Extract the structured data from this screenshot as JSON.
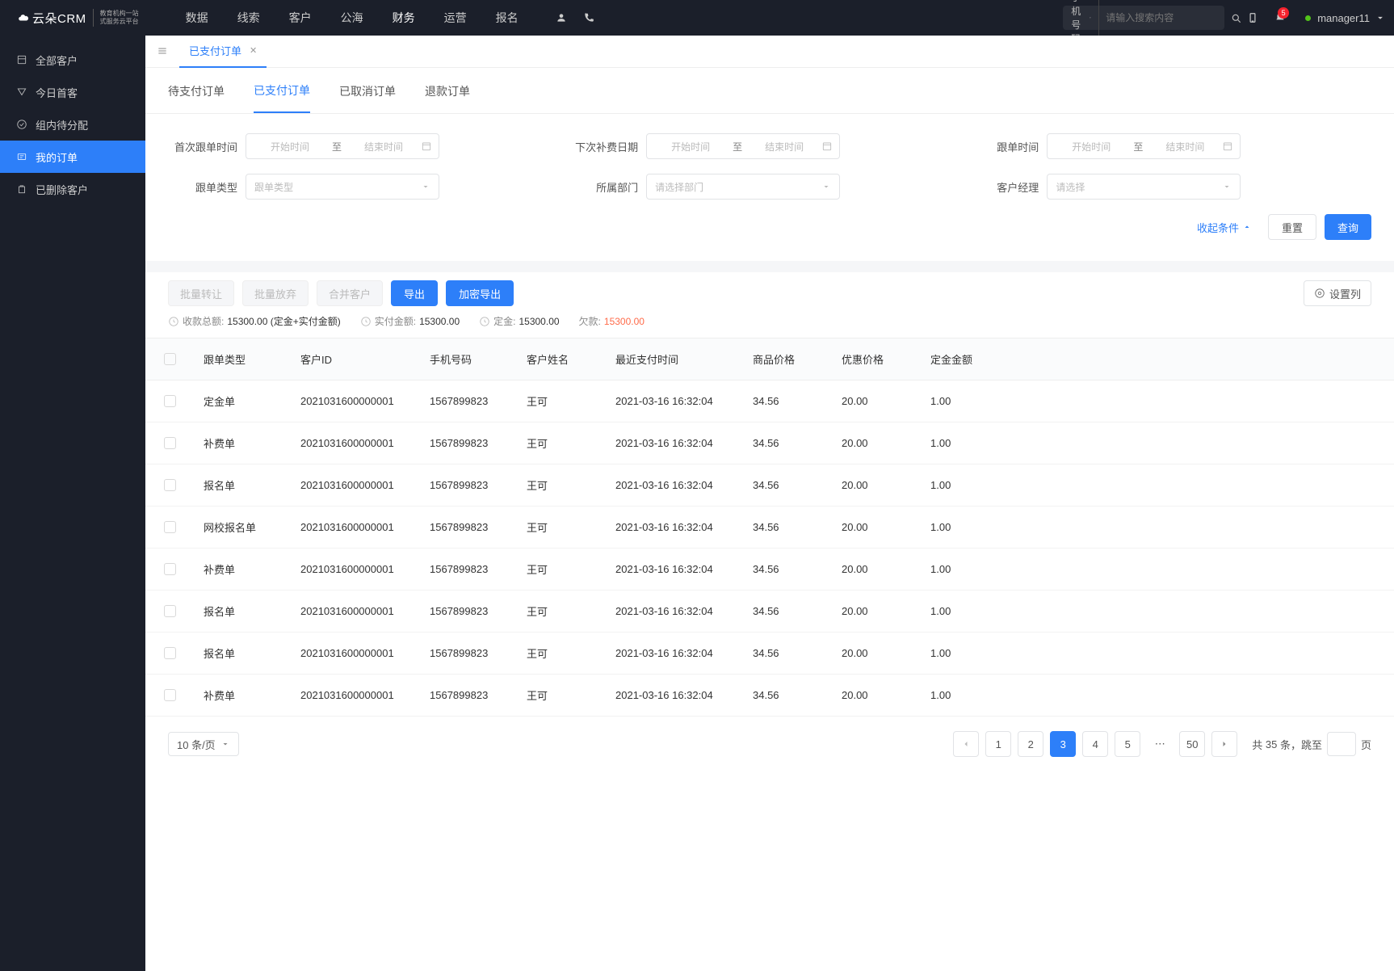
{
  "brand": {
    "name": "云朵CRM",
    "sub1": "教育机构一站",
    "sub2": "式服务云平台"
  },
  "topNav": [
    "数据",
    "线索",
    "客户",
    "公海",
    "财务",
    "运营",
    "报名"
  ],
  "topNavActive": "财务",
  "search": {
    "type": "手机号码",
    "placeholder": "请输入搜索内容"
  },
  "notificationCount": "5",
  "username": "manager11",
  "sidebar": {
    "items": [
      {
        "label": "全部客户"
      },
      {
        "label": "今日首客"
      },
      {
        "label": "组内待分配"
      },
      {
        "label": "我的订单"
      },
      {
        "label": "已删除客户"
      }
    ],
    "activeIndex": 3
  },
  "openTab": {
    "label": "已支付订单"
  },
  "subTabs": [
    "待支付订单",
    "已支付订单",
    "已取消订单",
    "退款订单"
  ],
  "subTabActive": "已支付订单",
  "filters": {
    "firstFollow": {
      "label": "首次跟单时间",
      "startPh": "开始时间",
      "sep": "至",
      "endPh": "结束时间"
    },
    "nextPay": {
      "label": "下次补费日期",
      "startPh": "开始时间",
      "sep": "至",
      "endPh": "结束时间"
    },
    "followTime": {
      "label": "跟单时间",
      "startPh": "开始时间",
      "sep": "至",
      "endPh": "结束时间"
    },
    "followType": {
      "label": "跟单类型",
      "placeholder": "跟单类型"
    },
    "dept": {
      "label": "所属部门",
      "placeholder": "请选择部门"
    },
    "manager": {
      "label": "客户经理",
      "placeholder": "请选择"
    },
    "collapse": "收起条件",
    "reset": "重置",
    "query": "查询"
  },
  "toolbar": {
    "batchTransfer": "批量转让",
    "batchGiveUp": "批量放弃",
    "mergeCustomer": "合并客户",
    "export": "导出",
    "encryptExport": "加密导出",
    "settings": "设置列"
  },
  "summary": {
    "total": {
      "label": "收款总额:",
      "value": "15300.00 (定金+实付金额)"
    },
    "paid": {
      "label": "实付金额:",
      "value": "15300.00"
    },
    "deposit": {
      "label": "定金:",
      "value": "15300.00"
    },
    "owe": {
      "label": "欠款:",
      "value": "15300.00"
    }
  },
  "table": {
    "headers": {
      "type": "跟单类型",
      "cid": "客户ID",
      "phone": "手机号码",
      "name": "客户姓名",
      "time": "最近支付时间",
      "price": "商品价格",
      "discount": "优惠价格",
      "deposit": "定金金额"
    },
    "rows": [
      {
        "type": "定金单",
        "cid": "2021031600000001",
        "phone": "1567899823",
        "name": "王可",
        "time": "2021-03-16 16:32:04",
        "price": "34.56",
        "discount": "20.00",
        "deposit": "1.00"
      },
      {
        "type": "补费单",
        "cid": "2021031600000001",
        "phone": "1567899823",
        "name": "王可",
        "time": "2021-03-16 16:32:04",
        "price": "34.56",
        "discount": "20.00",
        "deposit": "1.00"
      },
      {
        "type": "报名单",
        "cid": "2021031600000001",
        "phone": "1567899823",
        "name": "王可",
        "time": "2021-03-16 16:32:04",
        "price": "34.56",
        "discount": "20.00",
        "deposit": "1.00"
      },
      {
        "type": "网校报名单",
        "cid": "2021031600000001",
        "phone": "1567899823",
        "name": "王可",
        "time": "2021-03-16 16:32:04",
        "price": "34.56",
        "discount": "20.00",
        "deposit": "1.00"
      },
      {
        "type": "补费单",
        "cid": "2021031600000001",
        "phone": "1567899823",
        "name": "王可",
        "time": "2021-03-16 16:32:04",
        "price": "34.56",
        "discount": "20.00",
        "deposit": "1.00"
      },
      {
        "type": "报名单",
        "cid": "2021031600000001",
        "phone": "1567899823",
        "name": "王可",
        "time": "2021-03-16 16:32:04",
        "price": "34.56",
        "discount": "20.00",
        "deposit": "1.00"
      },
      {
        "type": "报名单",
        "cid": "2021031600000001",
        "phone": "1567899823",
        "name": "王可",
        "time": "2021-03-16 16:32:04",
        "price": "34.56",
        "discount": "20.00",
        "deposit": "1.00"
      },
      {
        "type": "补费单",
        "cid": "2021031600000001",
        "phone": "1567899823",
        "name": "王可",
        "time": "2021-03-16 16:32:04",
        "price": "34.56",
        "discount": "20.00",
        "deposit": "1.00"
      }
    ]
  },
  "pagination": {
    "pageSize": "10 条/页",
    "pages": [
      "1",
      "2",
      "3",
      "4",
      "5"
    ],
    "lastPage": "50",
    "activePage": "3",
    "totalPrefix": "共",
    "totalCount": "35",
    "totalSuffix": "条，跳至",
    "pageSuffix": "页"
  }
}
